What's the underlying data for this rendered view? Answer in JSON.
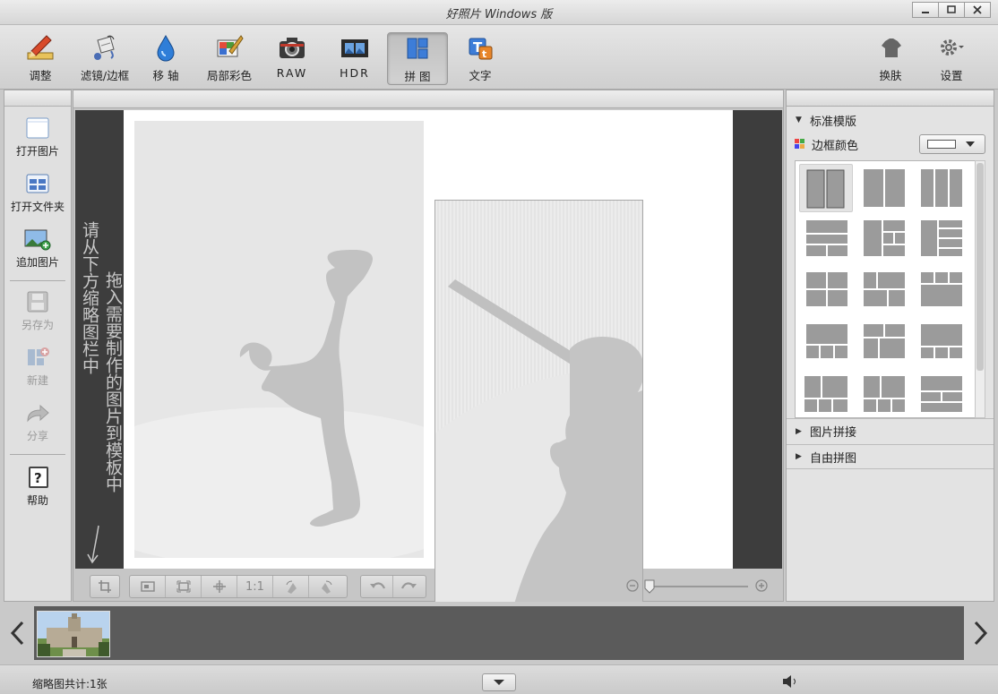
{
  "window": {
    "title": "好照片 Windows 版"
  },
  "toolbar": {
    "tools": [
      {
        "label": "调整",
        "icon": "pencil-ruler-icon"
      },
      {
        "label": "滤镜/边框",
        "icon": "paint-bucket-icon"
      },
      {
        "label": "移 轴",
        "icon": "water-drop-icon"
      },
      {
        "label": "局部彩色",
        "icon": "color-brush-icon"
      },
      {
        "label": "RAW",
        "icon": "camera-icon"
      },
      {
        "label": "HDR",
        "icon": "film-strip-icon"
      },
      {
        "label": "拼 图",
        "icon": "collage-icon"
      },
      {
        "label": "文字",
        "icon": "text-icon"
      }
    ],
    "active": "拼 图",
    "skin_label": "换肤",
    "settings_label": "设置"
  },
  "left_panel": {
    "open_image": "打开图片",
    "open_folder": "打开文件夹",
    "add_image": "追加图片",
    "save_as": "另存为",
    "new": "新建",
    "share": "分享",
    "help": "帮助"
  },
  "canvas": {
    "hint_col1": "请从下方缩略图栏中",
    "hint_col2": "拖入需要制作的图片到模板中",
    "zoom_ratio_label": "1:1"
  },
  "right_panel": {
    "standard_templates": "标准模版",
    "border_color": "边框颜色",
    "border_color_value": "#ffffff",
    "image_stitch": "图片拼接",
    "free_collage": "自由拼图"
  },
  "filmstrip": {
    "thumbnail_count": 1
  },
  "status": {
    "thumb_count_text": "缩略图共计:1张"
  }
}
